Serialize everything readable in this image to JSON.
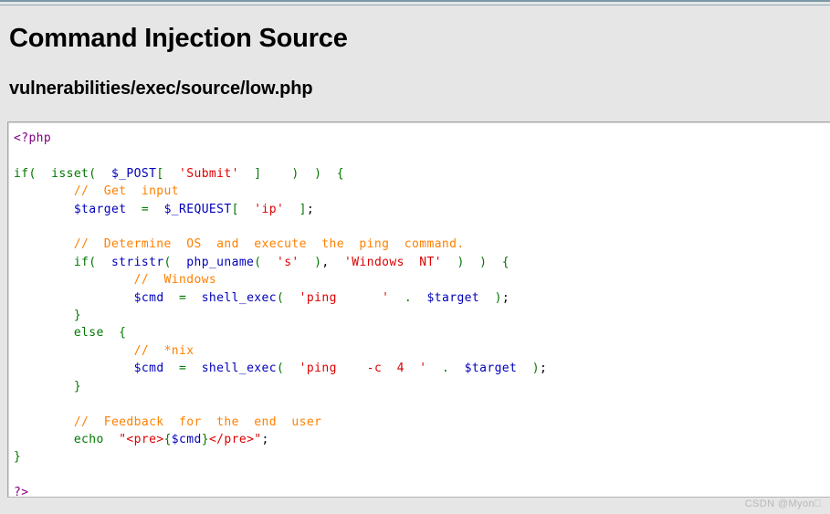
{
  "page": {
    "background_color": "#e6e6e6",
    "top_rule_color": "#7b98a6"
  },
  "header": {
    "title": "Command Injection Source",
    "subtitle": "vulnerabilities/exec/source/low.php"
  },
  "code_panel": {
    "language": "php",
    "background_color": "#ffffff",
    "border_color": "#b4b4b4",
    "syntax_colors": {
      "php_tag": "#800080",
      "keyword": "#007700",
      "variable": "#0000bb",
      "string": "#dd0000",
      "comment": "#ff8000",
      "punctuation": "#007700",
      "plain": "#000000"
    },
    "lines": [
      [
        {
          "t": "<?php",
          "c": "tag"
        }
      ],
      [],
      [
        {
          "t": "if(  isset(  ",
          "c": "kw"
        },
        {
          "t": "$_POST",
          "c": "var"
        },
        {
          "t": "[  ",
          "c": "pun"
        },
        {
          "t": "'Submit'",
          "c": "str"
        },
        {
          "t": "  ]    )  )  {",
          "c": "pun"
        }
      ],
      [
        {
          "t": "        //  Get  input",
          "c": "cmt"
        }
      ],
      [
        {
          "t": "        ",
          "c": "plain"
        },
        {
          "t": "$target",
          "c": "var"
        },
        {
          "t": "  =  ",
          "c": "pun"
        },
        {
          "t": "$_REQUEST",
          "c": "var"
        },
        {
          "t": "[  ",
          "c": "pun"
        },
        {
          "t": "'ip'",
          "c": "str"
        },
        {
          "t": "  ]",
          "c": "pun"
        },
        {
          "t": ";",
          "c": "plain"
        }
      ],
      [],
      [
        {
          "t": "        //  Determine  OS  and  execute  the  ping  command.",
          "c": "cmt"
        }
      ],
      [
        {
          "t": "        if(  ",
          "c": "kw"
        },
        {
          "t": "stristr",
          "c": "var"
        },
        {
          "t": "(  ",
          "c": "pun"
        },
        {
          "t": "php_uname",
          "c": "var"
        },
        {
          "t": "(  ",
          "c": "pun"
        },
        {
          "t": "'s'",
          "c": "str"
        },
        {
          "t": "  )",
          "c": "pun"
        },
        {
          "t": ",  ",
          "c": "plain"
        },
        {
          "t": "'Windows  NT'",
          "c": "str"
        },
        {
          "t": "  )  )  {",
          "c": "pun"
        }
      ],
      [
        {
          "t": "                //  Windows",
          "c": "cmt"
        }
      ],
      [
        {
          "t": "                ",
          "c": "plain"
        },
        {
          "t": "$cmd",
          "c": "var"
        },
        {
          "t": "  =  ",
          "c": "pun"
        },
        {
          "t": "shell_exec",
          "c": "var"
        },
        {
          "t": "(  ",
          "c": "pun"
        },
        {
          "t": "'ping      '",
          "c": "str"
        },
        {
          "t": "  .  ",
          "c": "pun"
        },
        {
          "t": "$target",
          "c": "var"
        },
        {
          "t": "  )",
          "c": "pun"
        },
        {
          "t": ";",
          "c": "plain"
        }
      ],
      [
        {
          "t": "        }",
          "c": "pun"
        }
      ],
      [
        {
          "t": "        else  {",
          "c": "kw"
        }
      ],
      [
        {
          "t": "                //  *nix",
          "c": "cmt"
        }
      ],
      [
        {
          "t": "                ",
          "c": "plain"
        },
        {
          "t": "$cmd",
          "c": "var"
        },
        {
          "t": "  =  ",
          "c": "pun"
        },
        {
          "t": "shell_exec",
          "c": "var"
        },
        {
          "t": "(  ",
          "c": "pun"
        },
        {
          "t": "'ping    -c  4  '",
          "c": "str"
        },
        {
          "t": "  .  ",
          "c": "pun"
        },
        {
          "t": "$target",
          "c": "var"
        },
        {
          "t": "  )",
          "c": "pun"
        },
        {
          "t": ";",
          "c": "plain"
        }
      ],
      [
        {
          "t": "        }",
          "c": "pun"
        }
      ],
      [],
      [
        {
          "t": "        //  Feedback  for  the  end  user",
          "c": "cmt"
        }
      ],
      [
        {
          "t": "        echo  ",
          "c": "kw"
        },
        {
          "t": "\"<pre>",
          "c": "str"
        },
        {
          "t": "{",
          "c": "pun"
        },
        {
          "t": "$cmd",
          "c": "var"
        },
        {
          "t": "}",
          "c": "pun"
        },
        {
          "t": "</pre>\"",
          "c": "str"
        },
        {
          "t": ";",
          "c": "plain"
        }
      ],
      [
        {
          "t": "}",
          "c": "pun"
        }
      ],
      [],
      [
        {
          "t": "?>",
          "c": "tag"
        }
      ]
    ]
  },
  "watermark": {
    "text": "CSDN @Myon⎕"
  }
}
